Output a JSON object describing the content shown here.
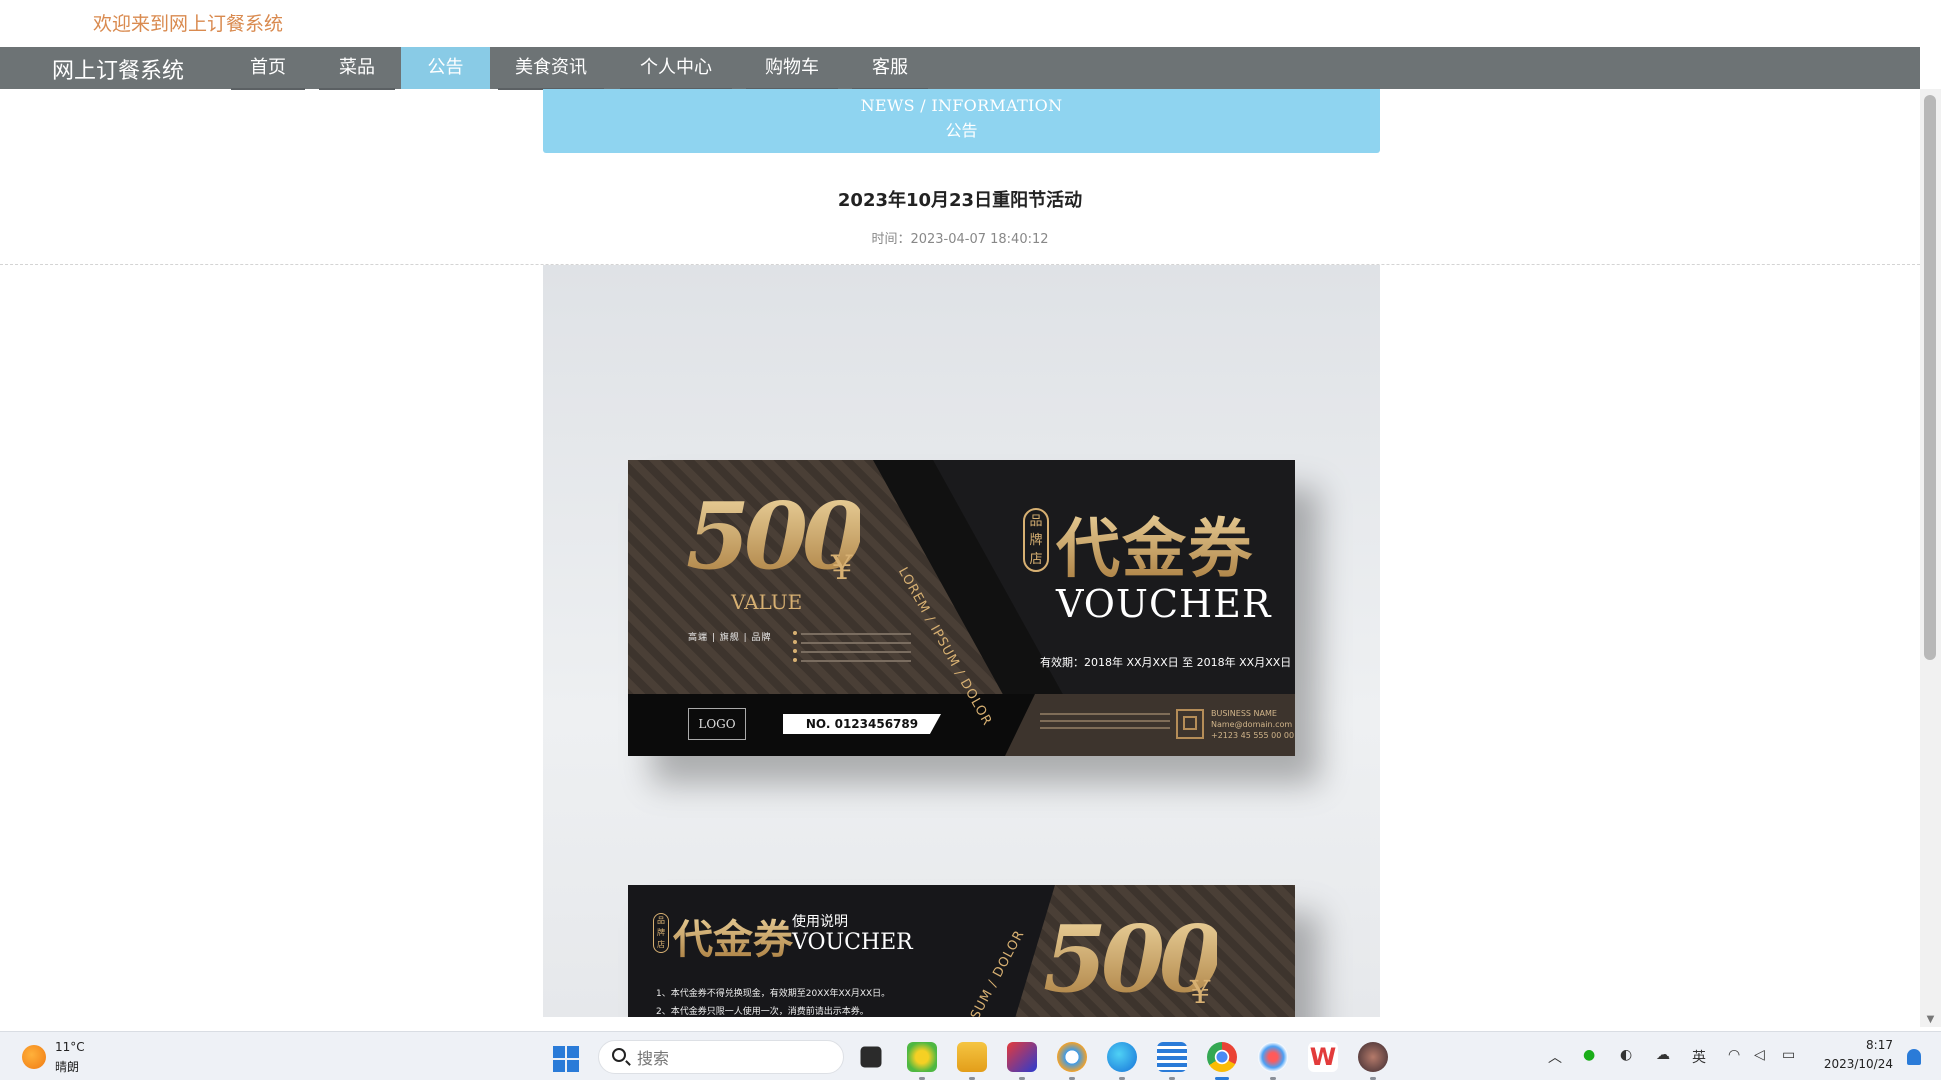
{
  "welcome": "欢迎来到网上订餐系统",
  "nav": {
    "brand": "网上订餐系统",
    "items": [
      "首页",
      "菜品",
      "公告",
      "美食资讯",
      "个人中心",
      "购物车",
      "客服"
    ],
    "active": "公告"
  },
  "banner": {
    "en": "NEWS / INFORMATION",
    "cn": "公告"
  },
  "article": {
    "title": "2023年10月23日重阳节活动",
    "time": "时间：2023-04-07 18:40:12"
  },
  "voucher": {
    "amount": "500",
    "currency": "¥",
    "value_label": "VALUE",
    "tags": "高端 | 旗舰 | 品牌",
    "side_text": "LOREM / IPSUM / DOLOR",
    "seal": "品牌店",
    "title_cn": "代金券",
    "title_en": "VOUCHER",
    "validity": "有效期：2018年 XX月XX日 至 2018年 XX月XX日",
    "logo": "LOGO",
    "serial": "NO. 0123456789",
    "business": [
      "BUSINESS NAME",
      "Name@domain.com",
      "+2123 45 555 00 00"
    ]
  },
  "voucher2": {
    "seal": "品牌店",
    "title_cn": "代金券",
    "usage": "使用说明",
    "title_en": "VOUCHER",
    "rules": [
      "1、本代金券不得兑换现金，有效期至20XX年XX月XX日。",
      "2、本代金券只限一人使用一次，消费前请出示本券。"
    ],
    "side_text": "SUM / DOLOR",
    "amount": "500",
    "currency": "¥"
  },
  "taskbar": {
    "temperature": "11°C",
    "weather": "晴朗",
    "search_placeholder": "搜索",
    "time": "8:17",
    "date": "2023/10/24",
    "ime": "英"
  },
  "colors": {
    "nav_bg": "#6d7375",
    "nav_active": "#89cbe6",
    "banner_bg": "#8fd4f0",
    "welcome_text": "#d98a4f",
    "gold": "#d7b072"
  }
}
